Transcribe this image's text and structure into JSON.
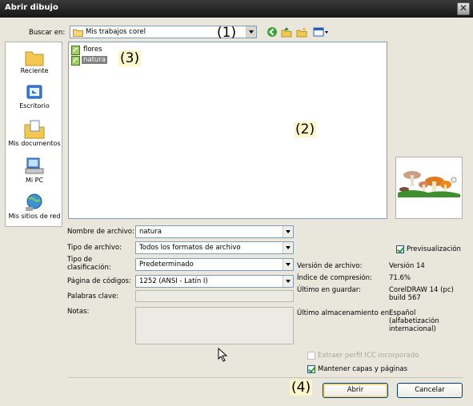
{
  "window": {
    "title": "Abrir dibujo",
    "close_glyph": "✕"
  },
  "lookin": {
    "label": "Buscar en:",
    "value": "Mis trabajos corel"
  },
  "toolbar": {
    "icons": [
      "back-icon",
      "up-folder-icon",
      "new-folder-icon",
      "view-menu-icon"
    ]
  },
  "places": [
    {
      "label": "Reciente",
      "icon": "recent-folder-icon"
    },
    {
      "label": "Escritorio",
      "icon": "desktop-icon"
    },
    {
      "label": "Mis documentos",
      "icon": "my-documents-icon"
    },
    {
      "label": "Mi PC",
      "icon": "my-computer-icon"
    },
    {
      "label": "Mis sitios de red",
      "icon": "network-places-icon"
    }
  ],
  "files": [
    {
      "name": "flores",
      "selected": false
    },
    {
      "name": "natura",
      "selected": true
    }
  ],
  "callouts": {
    "c1": "(1)",
    "c2": "(2)",
    "c3": "(3)",
    "c4": "(4)"
  },
  "form": {
    "filename_label": "Nombre de archivo:",
    "filename_value": "natura",
    "filetype_label": "Tipo de archivo:",
    "filetype_value": "Todos los formatos de archivo",
    "sorttype_label_1": "Tipo de",
    "sorttype_label_2": "clasificación:",
    "sorttype_value": "Predeterminado",
    "codepage_label": "Página de códigos:",
    "codepage_value": "1252  (ANSI - Latín I)",
    "keywords_label": "Palabras clave:",
    "notes_label": "Notas:"
  },
  "info": {
    "preview_label": "Previsualización",
    "preview_checked": true,
    "version_label": "Versión de archivo:",
    "version_value": "Versión 14",
    "compression_label": "Índice de compresión:",
    "compression_value": "71.6%",
    "lastsaved_label": "Último en guardar:",
    "lastsaved_value_1": "CorelDRAW 14 (pc)",
    "lastsaved_value_2": "build 567",
    "lastsort_label": "Último almacenamiento en:",
    "lastsort_value_1": "Español",
    "lastsort_value_2": "(alfabetización",
    "lastsort_value_3": "internacional)"
  },
  "options": {
    "icc_label": "Extraer perfil ICC incorporado",
    "icc_checked": false,
    "layers_label": "Mantener capas y páginas",
    "layers_checked": true
  },
  "buttons": {
    "open": "Abrir",
    "cancel": "Cancelar"
  },
  "colors": {
    "titlebar": "#161616",
    "dialog": "#e9e7dc",
    "selection": "#808080",
    "callout_bg": "#fdf6c8"
  }
}
